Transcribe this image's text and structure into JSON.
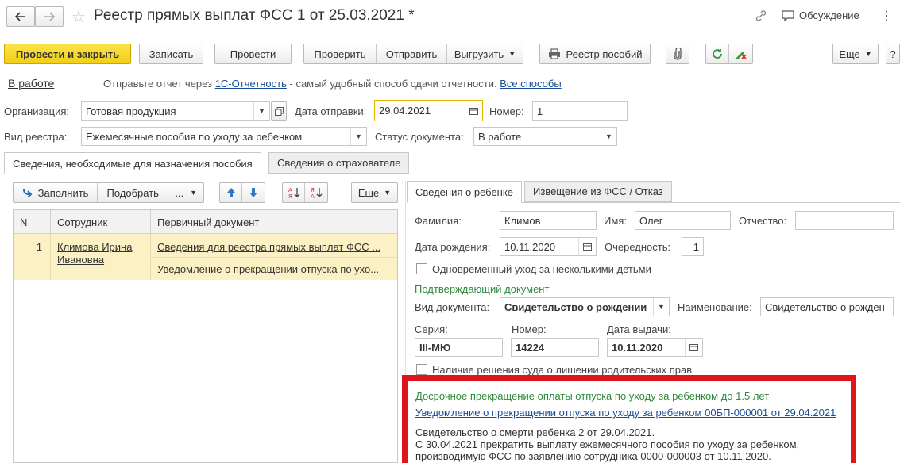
{
  "window": {
    "title": "Реестр прямых выплат ФСС 1 от 25.03.2021 *",
    "discussion_label": "Обсуждение",
    "more_glyph": "⋮"
  },
  "toolbar": {
    "post_close": "Провести и закрыть",
    "save": "Записать",
    "post": "Провести",
    "check": "Проверить",
    "send": "Отправить",
    "export": "Выгрузить",
    "benefits_registry": "Реестр пособий",
    "more": "Еще"
  },
  "status_line": {
    "state": "В работе",
    "hint_prefix": "Отправьте отчет через",
    "hint_link": "1С-Отчетность",
    "hint_suffix": "- самый удобный способ сдачи отчетности.",
    "all_ways": "Все способы"
  },
  "form": {
    "org_label": "Организация:",
    "org_value": "Готовая продукция",
    "send_date_label": "Дата отправки:",
    "send_date_value": "29.04.2021",
    "number_label": "Номер:",
    "number_value": "1",
    "registry_type_label": "Вид реестра:",
    "registry_type_value": "Ежемесячные пособия по уходу за ребенком",
    "doc_status_label": "Статус документа:",
    "doc_status_value": "В работе"
  },
  "tabs": [
    {
      "label": "Сведения, необходимые для назначения пособия"
    },
    {
      "label": "Сведения о страхователе"
    }
  ],
  "left_panel": {
    "fill": "Заполнить",
    "pick": "Подобрать",
    "dots": "...",
    "more": "Еще",
    "columns": [
      "N",
      "Сотрудник",
      "Первичный документ"
    ],
    "rows": [
      {
        "n": "1",
        "employee": "Климова Ирина Ивановна",
        "doc1": "Сведения для реестра прямых выплат ФСС ...",
        "doc2": "Уведомление о прекращении отпуска по ухо..."
      }
    ]
  },
  "right_tabs": [
    {
      "label": "Сведения о ребенке"
    },
    {
      "label": "Извещение из ФСС / Отказ"
    }
  ],
  "child": {
    "surname_label": "Фамилия:",
    "surname_value": "Климов",
    "name_label": "Имя:",
    "name_value": "Олег",
    "patronymic_label": "Отчество:",
    "patronymic_value": "",
    "birth_label": "Дата рождения:",
    "birth_value": "10.11.2020",
    "order_label": "Очередность:",
    "order_value": "1",
    "multi_care": "Одновременный уход за несколькими детьми",
    "confirm_doc_header": "Подтверждающий документ",
    "doc_type_label": "Вид документа:",
    "doc_type_value": "Свидетельство о рождении",
    "doc_name_label": "Наименование:",
    "doc_name_value": "Свидетельство о рожден",
    "series_label": "Серия:",
    "series_value": "III-МЮ",
    "num_label": "Номер:",
    "num_value": "14224",
    "issue_label": "Дата выдачи:",
    "issue_value": "10.11.2020",
    "court_decision": "Наличие решения суда о лишении родительских прав"
  },
  "notice": {
    "title": "Досрочное прекращение оплаты отпуска по уходу за ребенком до 1.5 лет",
    "link": "Уведомление о прекращении отпуска по уходу за ребенком 00БП-000001 от 29.04.2021",
    "line1": "Свидетельство о смерти ребенка 2 от 29.04.2021.",
    "line2": "С 30.04.2021 прекратить выплату ежемесячного пособия по уходу за ребенком,",
    "line3": "производимую ФСС по заявлению сотрудника 0000-000003 от 10.11.2020."
  },
  "colors": {
    "primary_button": "#f2cf14",
    "selected_row": "#fbf1c4",
    "highlight_box": "#e0151b",
    "link": "#1a4d99",
    "green_header": "#2f8a3a"
  }
}
